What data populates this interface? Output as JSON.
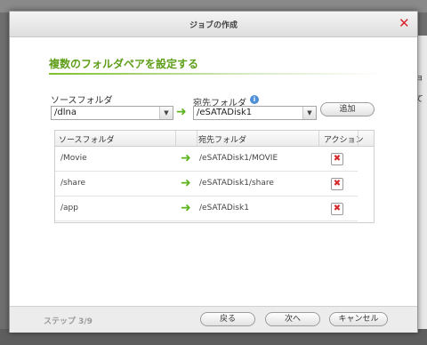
{
  "dialog": {
    "title": "ジョブの作成"
  },
  "section_heading": "複数のフォルダペアを設定する",
  "source": {
    "label": "ソースフォルダ",
    "value": "/dlna"
  },
  "destination": {
    "label": "宛先フォルダ",
    "value": "/eSATADisk1"
  },
  "add_button": "追加",
  "table": {
    "headers": [
      "ソースフォルダ",
      "宛先フォルダ",
      "アクション"
    ],
    "rows": [
      {
        "source": "/Movie",
        "dest": "/eSATADisk1/MOVIE"
      },
      {
        "source": "/share",
        "dest": "/eSATADisk1/share"
      },
      {
        "source": "/app",
        "dest": "/eSATADisk1"
      }
    ]
  },
  "footer": {
    "step": "ステップ 3/9",
    "back": "戻る",
    "next": "次へ",
    "cancel": "キャンセル"
  },
  "background_text": [
    "ジョブ",
    "れて"
  ],
  "colors": {
    "accent_green": "#5e9e18",
    "close_red": "#d8262c",
    "arrow_green": "#5cb31e"
  }
}
